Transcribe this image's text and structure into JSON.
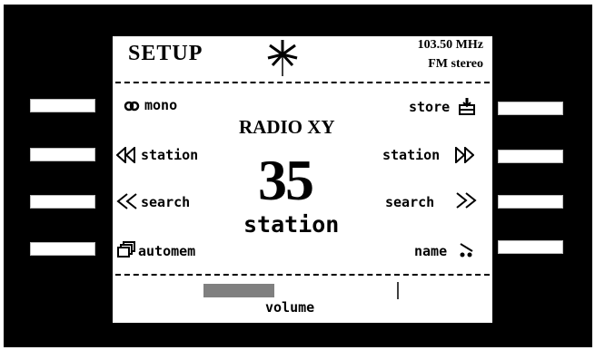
{
  "screen": {
    "title": "SETUP",
    "frequency": "103.50 MHz",
    "audio_mode": "FM stereo",
    "station_name": "RADIO XY",
    "station_number": "35",
    "station_word": "station"
  },
  "left_menu": [
    {
      "label": "mono",
      "icon": "mono-icon"
    },
    {
      "label": "station",
      "icon": "double-arrow-left-icon"
    },
    {
      "label": "search",
      "icon": "chevron-double-left-icon"
    },
    {
      "label": "automem",
      "icon": "memory-stack-icon"
    }
  ],
  "right_menu": [
    {
      "label": "store",
      "icon": "store-icon"
    },
    {
      "label": "station",
      "icon": "double-arrow-right-icon"
    },
    {
      "label": "search",
      "icon": "chevron-double-right-icon"
    },
    {
      "label": "name",
      "icon": "name-icon"
    }
  ],
  "volume": {
    "label": "volume",
    "level": 0.36
  },
  "colors": {
    "frame": "#000000",
    "screen": "#ffffff",
    "text": "#000000"
  }
}
